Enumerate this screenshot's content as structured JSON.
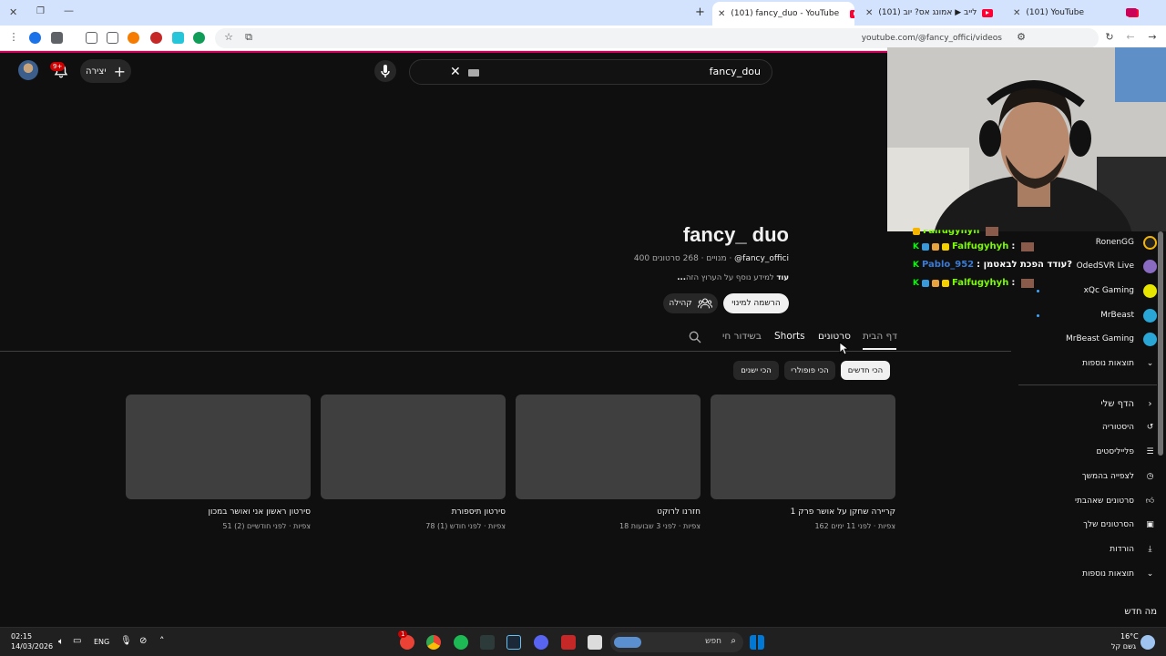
{
  "browser": {
    "tabs": [
      {
        "title": "(101) YouTube",
        "active": false
      },
      {
        "title": "(101) לייב ▶ אמונג אס? יוב",
        "active": false
      },
      {
        "title": "(101) fancy_duo - YouTube",
        "active": true
      }
    ],
    "url": "youtube.com/@fancy_offici/videos"
  },
  "masthead": {
    "search_query": "fancy_dou",
    "create_label": "יצירה",
    "notification_count": "9+"
  },
  "channel": {
    "name": "fancy_ duo",
    "handle": "@fancy_offici",
    "stats": "400 מנויים · 268 סרטונים",
    "description": "למידע נוסף על הערוץ הזה",
    "description_more": "...עוד",
    "subscribe_label": "הרשמה למינוי",
    "community_label": "קהילה"
  },
  "tabs": {
    "home": "דף הבית",
    "videos": "סרטונים",
    "shorts": "Shorts",
    "live": "בשידור חי"
  },
  "chips": {
    "newest": "הכי חדשים",
    "popular": "הכי פופולרי",
    "oldest": "הכי ישנים"
  },
  "videos": [
    {
      "title": "קריירה שחקן על אושר פרק 1",
      "meta": "162 צפיות · לפני 11 ימים"
    },
    {
      "title": "חזרנו לרוקט",
      "meta": "18 צפיות · לפני 3 שבועות"
    },
    {
      "title": "סירטון תיספורת",
      "meta": "78 צפיות · לפני חודש (1)"
    },
    {
      "title": "סירטון ראשון אני ואושר במכון",
      "meta": "51 צפיות · לפני חודשיים (2)"
    }
  ],
  "chat": [
    {
      "user": "Falfugyhyh",
      "text": "",
      "color": "#7cfc00"
    },
    {
      "user": "Falfugyhyh",
      "text": ":",
      "color": "#7cfc00"
    },
    {
      "user": "Pablo_952",
      "text": ": עודד הפכת לבאטמן?",
      "color": "#3a7bd5"
    },
    {
      "user": "Falfugyhyh",
      "text": ":",
      "color": "#7cfc00"
    }
  ],
  "sidebar": {
    "subscriptions": [
      {
        "label": "RonenGG"
      },
      {
        "label": "OdedSVR Live"
      },
      {
        "label": "xQc Gaming"
      },
      {
        "label": "MrBeast"
      },
      {
        "label": "MrBeast Gaming"
      },
      {
        "label": "תוצאות נוספות"
      }
    ],
    "you_header": "הדף שלי",
    "you_items": [
      {
        "label": "היסטוריה"
      },
      {
        "label": "פלייליסטים"
      },
      {
        "label": "לצפייה בהמשך"
      },
      {
        "label": "סרטונים שאהבתי"
      },
      {
        "label": "הסרטונים שלך"
      },
      {
        "label": "הורדות"
      },
      {
        "label": "תוצאות נוספות"
      }
    ],
    "whats_new": "מה חדש"
  },
  "taskbar": {
    "time": "02:15",
    "date": "14/03/2026",
    "lang": "ENG",
    "search_placeholder": "חפש",
    "weather_temp": "16°C",
    "weather_desc": "גשם קל",
    "badge": "1"
  },
  "colors": {
    "accent": "#cc0058",
    "chat_green": "#7cfc00",
    "chat_blue": "#3a7bd5"
  }
}
